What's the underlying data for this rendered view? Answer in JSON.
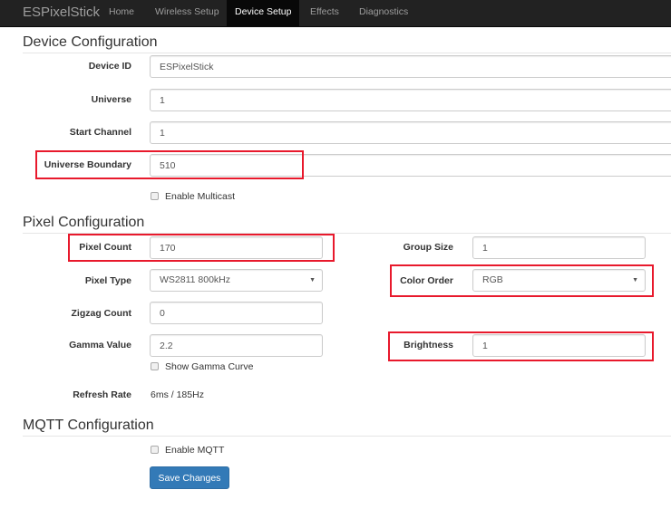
{
  "navbar": {
    "brand": "ESPixelStick",
    "items": [
      "Home",
      "Wireless Setup",
      "Device Setup",
      "Effects",
      "Diagnostics"
    ],
    "active": "Device Setup"
  },
  "device": {
    "title": "Device Configuration",
    "device_id_label": "Device ID",
    "device_id_value": "ESPixelStick",
    "universe_label": "Universe",
    "universe_value": "1",
    "start_channel_label": "Start Channel",
    "start_channel_value": "1",
    "universe_boundary_label": "Universe Boundary",
    "universe_boundary_value": "510",
    "multicast_label": "Enable Multicast"
  },
  "pixel": {
    "title": "Pixel Configuration",
    "pixel_count_label": "Pixel Count",
    "pixel_count_value": "170",
    "group_size_label": "Group Size",
    "group_size_value": "1",
    "pixel_type_label": "Pixel Type",
    "pixel_type_value": "WS2811 800kHz",
    "color_order_label": "Color Order",
    "color_order_value": "RGB",
    "zigzag_label": "Zigzag Count",
    "zigzag_value": "0",
    "gamma_label": "Gamma Value",
    "gamma_value": "2.2",
    "brightness_label": "Brightness",
    "brightness_value": "1",
    "gamma_curve_label": "Show Gamma Curve",
    "refresh_label": "Refresh Rate",
    "refresh_value": "6ms / 185Hz"
  },
  "mqtt": {
    "title": "MQTT Configuration",
    "enable_label": "Enable MQTT"
  },
  "actions": {
    "save_label": "Save Changes"
  },
  "colors": {
    "navbar": "#222222",
    "primary": "#337ab7",
    "highlight": "#e8192c"
  }
}
